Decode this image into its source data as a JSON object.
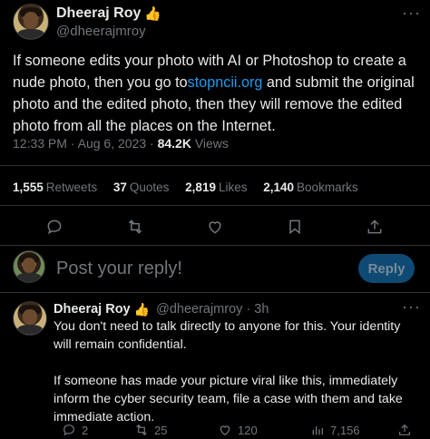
{
  "tweet": {
    "author_name": "Dheeraj Roy",
    "author_badge": "👍",
    "author_handle": "@dheerajmroy",
    "more": "···",
    "text_before_link": "If someone edits your photo with AI or Photoshop to create a nude photo, then you go to",
    "link": "stopncii.org",
    "text_after_link": " and submit the original photo and the edited photo, then they will remove the edited photo from all the places on the Internet.",
    "time": "12:33 PM",
    "date": "Aug 6, 2023",
    "views_count": "84.2K",
    "views_label": "Views",
    "stats": {
      "retweets_count": "1,555",
      "retweets_label": "Retweets",
      "quotes_count": "37",
      "quotes_label": "Quotes",
      "likes_count": "2,819",
      "likes_label": "Likes",
      "bookmarks_count": "2,140",
      "bookmarks_label": "Bookmarks"
    }
  },
  "compose": {
    "placeholder": "Post your reply!",
    "reply_button": "Reply"
  },
  "reply": {
    "author_name": "Dheeraj Roy",
    "author_badge": "👍",
    "author_handle": "@dheerajmroy",
    "age": "· 3h",
    "more": "···",
    "paragraph1": "You don't need to talk directly to anyone for this. Your identity will remain confidential.",
    "paragraph2": "If someone has made your picture viral like this, immediately inform the cyber security team, file a case with them and take immediate action.",
    "replies_count": "2",
    "retweets_count": "25",
    "likes_count": "120",
    "views_count": "7,156"
  },
  "colors": {
    "background": "#000000",
    "text": "#e7e9ea",
    "muted": "#71767b",
    "link": "#1d9bf0",
    "reply_button_bg": "#0e4a73"
  },
  "icons": {
    "reply": "reply-icon",
    "retweet": "retweet-icon",
    "like": "heart-icon",
    "bookmark": "bookmark-icon",
    "share": "share-icon",
    "views": "views-icon"
  }
}
